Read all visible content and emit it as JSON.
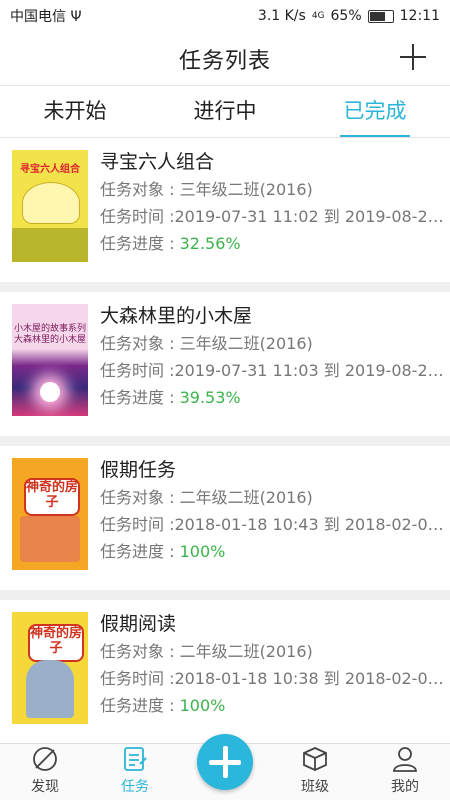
{
  "status": {
    "carrier": "中国电信",
    "usb": "Ψ",
    "speed": "3.1 K/s",
    "net": "4G",
    "battery": "65%",
    "battery_level": 0.65,
    "time": "12:11"
  },
  "header": {
    "title": "任务列表"
  },
  "tabs": [
    {
      "label": "未开始"
    },
    {
      "label": "进行中"
    },
    {
      "label": "已完成"
    }
  ],
  "tasks": [
    {
      "name": "寻宝六人组合",
      "target": "任务对象 : 三年级二班(2016)",
      "time": "任务时间 :2019-07-31 11:02 到 2019-08-2…",
      "progress_label": "任务进度 : ",
      "progress": "32.56%",
      "cover_text": "寻宝六人组合"
    },
    {
      "name": "大森林里的小木屋",
      "target": "任务对象 : 三年级二班(2016)",
      "time": "任务时间 :2019-07-31 11:03 到 2019-08-2…",
      "progress_label": "任务进度 : ",
      "progress": "39.53%",
      "cover_text": "小木屋的故事系列 大森林里的小木屋"
    },
    {
      "name": "假期任务",
      "target": "任务对象 : 二年级二班(2016)",
      "time": "任务时间 :2018-01-18 10:43 到 2018-02-0…",
      "progress_label": "任务进度 : ",
      "progress": "100%",
      "cover_text": "神奇的房子"
    },
    {
      "name": "假期阅读",
      "target": "任务对象 : 二年级二班(2016)",
      "time": "任务时间 :2018-01-18 10:38 到 2018-02-0…",
      "progress_label": "任务进度 : ",
      "progress": "100%",
      "cover_text": "神奇的房子"
    }
  ],
  "nav": [
    {
      "label": "发现",
      "icon": "discover-icon"
    },
    {
      "label": "任务",
      "icon": "task-icon"
    },
    {
      "label": "",
      "icon": "add-icon"
    },
    {
      "label": "班级",
      "icon": "class-icon"
    },
    {
      "label": "我的",
      "icon": "profile-icon"
    }
  ],
  "colors": {
    "accent": "#29b6d8",
    "progress": "#3cb34a"
  }
}
